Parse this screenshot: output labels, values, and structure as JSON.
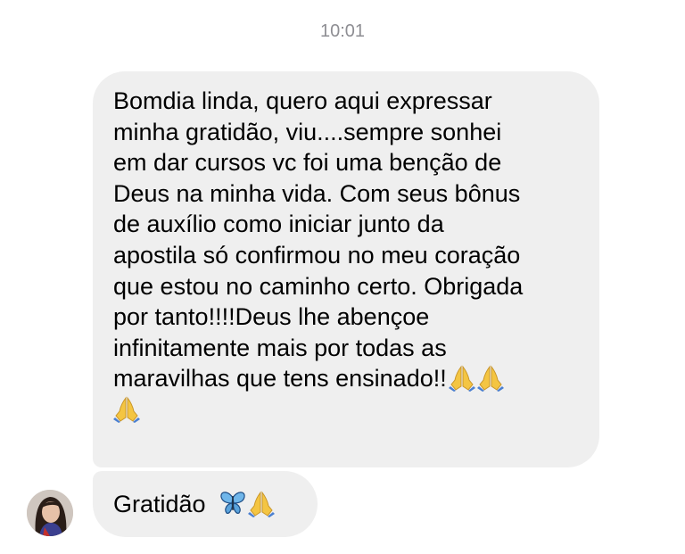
{
  "timestamp": "10:01",
  "message_main": {
    "lines": [
      "Bomdia linda, quero aqui expressar",
      "minha gratidão, viu....sempre sonhei",
      "em dar cursos  vc foi uma benção de",
      "Deus na minha vida. Com seus bônus",
      "de auxílio como iniciar junto da",
      "apostila só confirmou no meu coração",
      "que estou no caminho certo. Obrigada",
      "por tanto!!!!Deus lhe abençoe",
      "infinitamente mais por todas as",
      "maravilhas que tens ensinado!!"
    ],
    "trailing_emoji": [
      "folded-hands",
      "folded-hands"
    ],
    "wrapped_emoji": [
      "folded-hands"
    ]
  },
  "message_short": {
    "text": "Gratidão",
    "emoji": [
      "butterfly",
      "folded-hands"
    ]
  },
  "sender": {
    "avatar_icon": "profile-photo"
  },
  "colors": {
    "bubble_background": "#efefef",
    "timestamp_text": "#8e8e93",
    "message_text": "#000000"
  }
}
